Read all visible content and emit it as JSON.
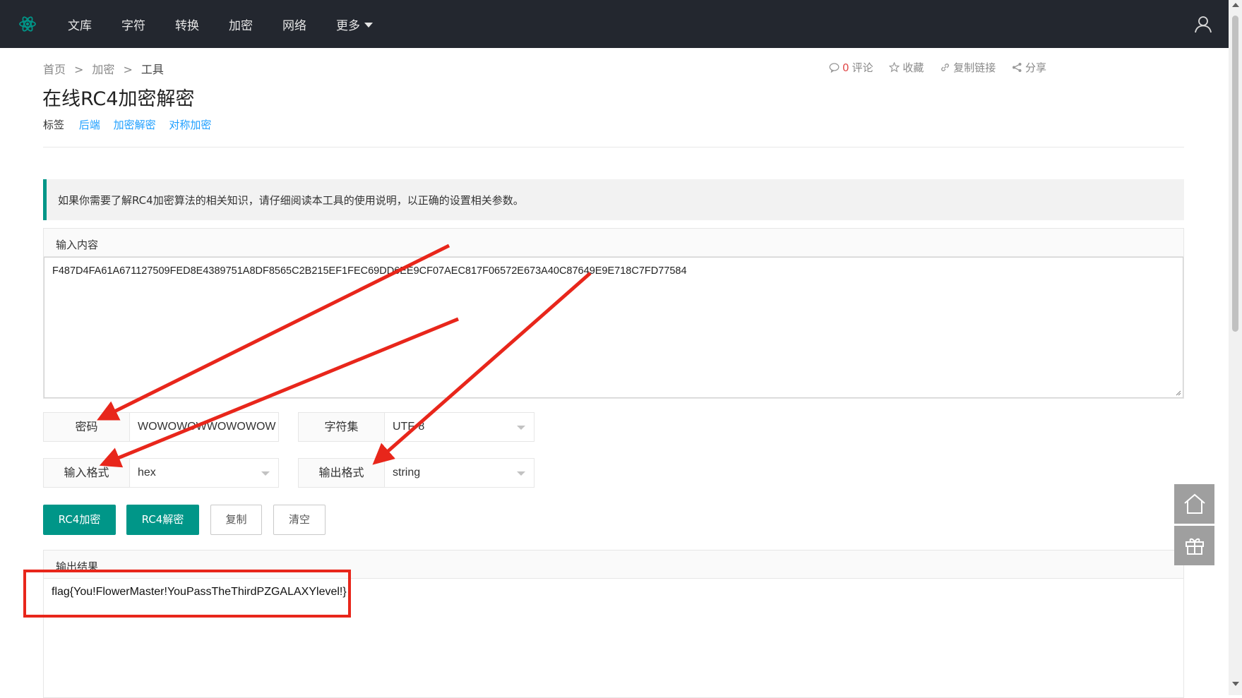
{
  "nav": {
    "items": [
      "文库",
      "字符",
      "转换",
      "加密",
      "网络"
    ],
    "more_label": "更多"
  },
  "breadcrumb": {
    "home": "首页",
    "section": "加密",
    "current": "工具",
    "sep": ">"
  },
  "actions": {
    "comment_count": "0",
    "comment_label": "评论",
    "favorite_label": "收藏",
    "copy_link_label": "复制链接",
    "share_label": "分享"
  },
  "page": {
    "title": "在线RC4加密解密",
    "tags_label": "标签",
    "tags": [
      "后端",
      "加密解密",
      "对称加密"
    ]
  },
  "notice": {
    "text": "如果你需要了解RC4加密算法的相关知识，请仔细阅读本工具的使用说明，以正确的设置相关参数。"
  },
  "input": {
    "header": "输入内容",
    "value": "F487D4FA61A671127509FED8E4389751A8DF8565C2B215EF1FEC69DD6EE9CF07AEC817F06572E673A40C87649E9E718C7FD77584"
  },
  "fields": {
    "password_label": "密码",
    "password_value": "WOWOWOWWOWOWOW",
    "charset_label": "字符集",
    "charset_value": "UTF-8",
    "input_format_label": "输入格式",
    "input_format_value": "hex",
    "output_format_label": "输出格式",
    "output_format_value": "string"
  },
  "buttons": {
    "encrypt": "RC4加密",
    "decrypt": "RC4解密",
    "copy": "复制",
    "clear": "清空"
  },
  "output": {
    "header": "输出结果",
    "value": "flag{You!FlowerMaster!YouPassTheThirdPZGALAXYlevel!}"
  },
  "colors": {
    "navbar": "#23272f",
    "accent": "#009688",
    "link": "#1e9fff",
    "annotation": "#e8261b"
  }
}
